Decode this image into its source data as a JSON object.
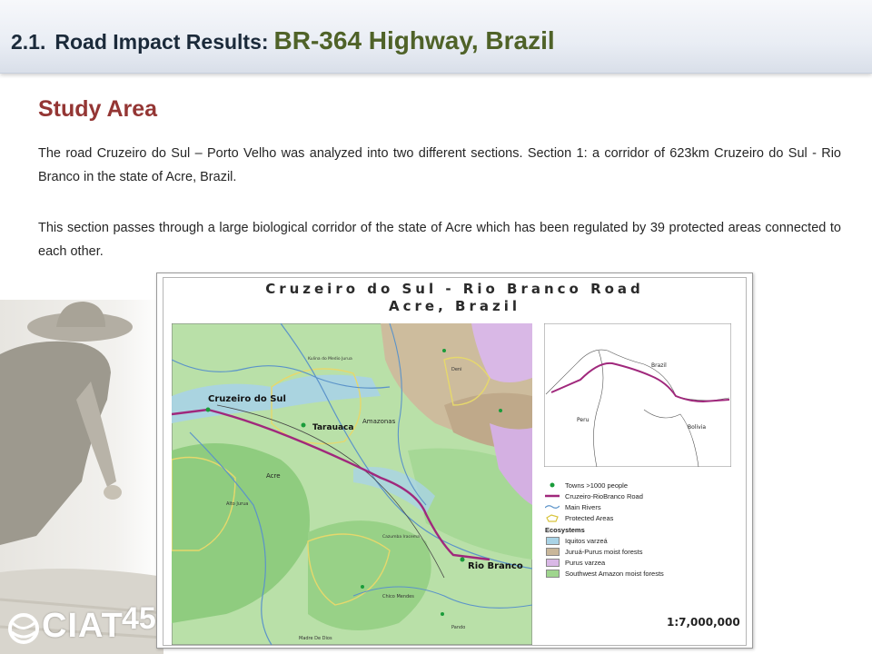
{
  "header": {
    "number": "2.1.",
    "title": "Road Impact Results:",
    "subtitle": "BR-364 Highway, Brazil"
  },
  "section": {
    "title": "Study Area",
    "paragraph1": "The road Cruzeiro do Sul – Porto Velho was analyzed into two different sections.  Section 1: a corridor of 623km Cruzeiro do Sul - Rio Branco in the state of Acre, Brazil.",
    "paragraph2": "This section passes through a large biological corridor of the state of Acre which has been regulated by 39 protected areas connected to each other."
  },
  "map": {
    "title_line1": "Cruzeiro do Sul - Rio Branco Road",
    "title_line2": "Acre, Brazil",
    "labels": {
      "cruzeiro": "Cruzeiro do Sul",
      "tarauaca": "Tarauaca",
      "amazonas": "Amazonas",
      "acre": "Acre",
      "rio_branco": "Rio Branco",
      "chico_mendes": "Chico Mendes",
      "alto_jurua": "Alto Jurua",
      "pando": "Pando",
      "madre_de_dios": "Madre De Dios",
      "deni": "Deni",
      "kulina": "Kulina do Medio Jurua",
      "cazumba": "Cazumba Iracema"
    },
    "inset": {
      "brazil": "Brazil",
      "peru": "Peru",
      "bolivia": "Bolivia"
    },
    "legend": {
      "towns": "Towns >1000 people",
      "road": "Cruzeiro-RioBranco Road",
      "rivers": "Main Rivers",
      "protected": "Protected Areas",
      "ecosystems": "Ecosystems",
      "iquitos": "Iquitos varzeá",
      "jurua": "Juruá-Purus moist forests",
      "purus": "Purus varzea",
      "southwest": "Southwest Amazon moist forests"
    },
    "scale": "1:7,000,000",
    "colors": {
      "forest": "#9fd58e",
      "jurua": "#c9b79a",
      "purus": "#d9b8e6",
      "iquitos": "#a9d3e6",
      "road": "#a0287c",
      "river": "#5b93c9"
    }
  },
  "logo": {
    "text": "CIAT",
    "number": "45"
  }
}
